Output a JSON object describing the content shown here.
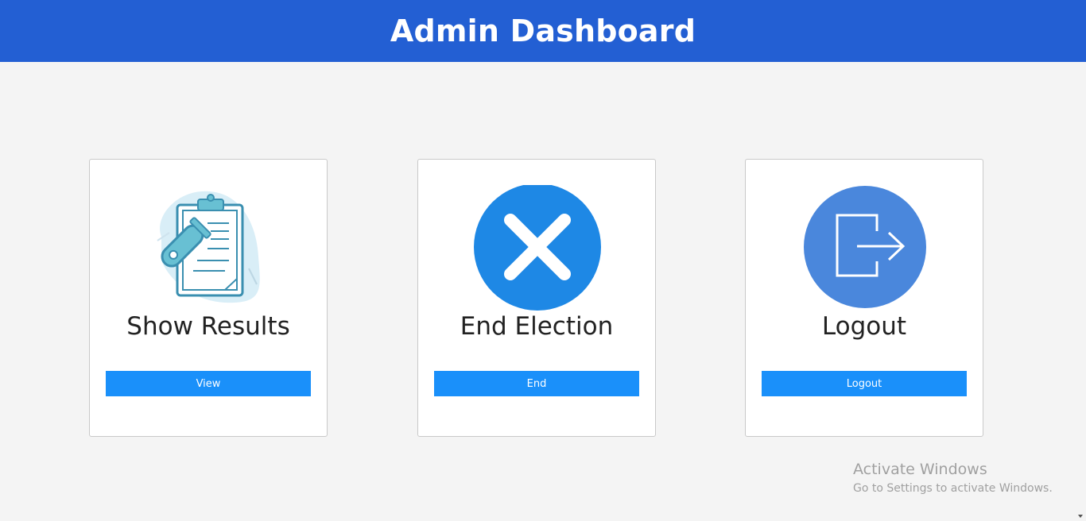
{
  "header": {
    "title": "Admin Dashboard"
  },
  "cards": [
    {
      "title": "Show Results",
      "button_label": "View",
      "icon": "clipboard-test-tube-icon"
    },
    {
      "title": "End Election",
      "button_label": "End",
      "icon": "close-circle-icon"
    },
    {
      "title": "Logout",
      "button_label": "Logout",
      "icon": "logout-icon"
    }
  ],
  "watermark": {
    "title": "Activate Windows",
    "subtitle": "Go to Settings to activate Windows."
  },
  "colors": {
    "header_bg": "#235fd3",
    "button_bg": "#1a90fa",
    "close_circle": "#1e88e5",
    "logout_circle": "#4a87dc",
    "page_bg": "#f4f4f4"
  }
}
